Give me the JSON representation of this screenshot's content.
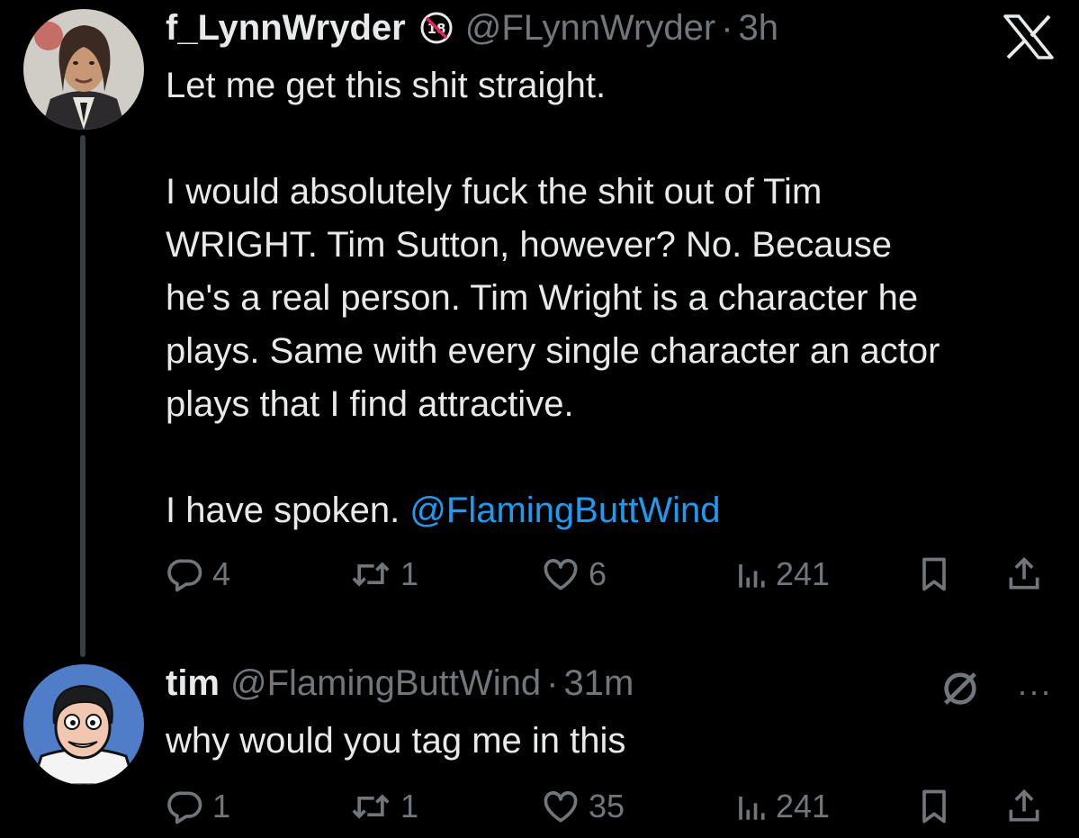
{
  "tweet1": {
    "display_name": "f_LynnWryder",
    "badge_icon": "18-plus-icon",
    "handle": "@FLynnWryder",
    "separator": "·",
    "time": "3h",
    "paragraph1": "Let me get this shit straight.",
    "paragraph2_line1": "I would absolutely fuck the shit out of Tim",
    "paragraph2_line2": "WRIGHT. Tim Sutton, however? No. Because",
    "paragraph2_line3": "he's a real person. Tim Wright is a character he",
    "paragraph2_line4": "plays. Same with every single character an actor",
    "paragraph2_line5": "plays that I find attractive.",
    "paragraph3_text": "I have spoken. ",
    "paragraph3_mention": "@FlamingButtWind",
    "actions": {
      "replies": "4",
      "reposts": "1",
      "likes": "6",
      "views": "241"
    }
  },
  "tweet2": {
    "display_name": "tim",
    "handle": "@FlamingButtWind",
    "separator": "·",
    "time": "31m",
    "text": "why would you tag me in this",
    "actions": {
      "replies": "1",
      "reposts": "1",
      "likes": "35",
      "views": "241"
    },
    "more_label": "···"
  },
  "colors": {
    "background": "#000000",
    "text_primary": "#e7e9ea",
    "text_secondary": "#71767b",
    "link": "#1d9bf0",
    "thread_line": "#3a3d40"
  },
  "icons": [
    "x-logo-icon",
    "reply-icon",
    "repost-icon",
    "like-icon",
    "views-icon",
    "bookmark-icon",
    "share-icon",
    "no-replies-icon",
    "more-icon"
  ]
}
